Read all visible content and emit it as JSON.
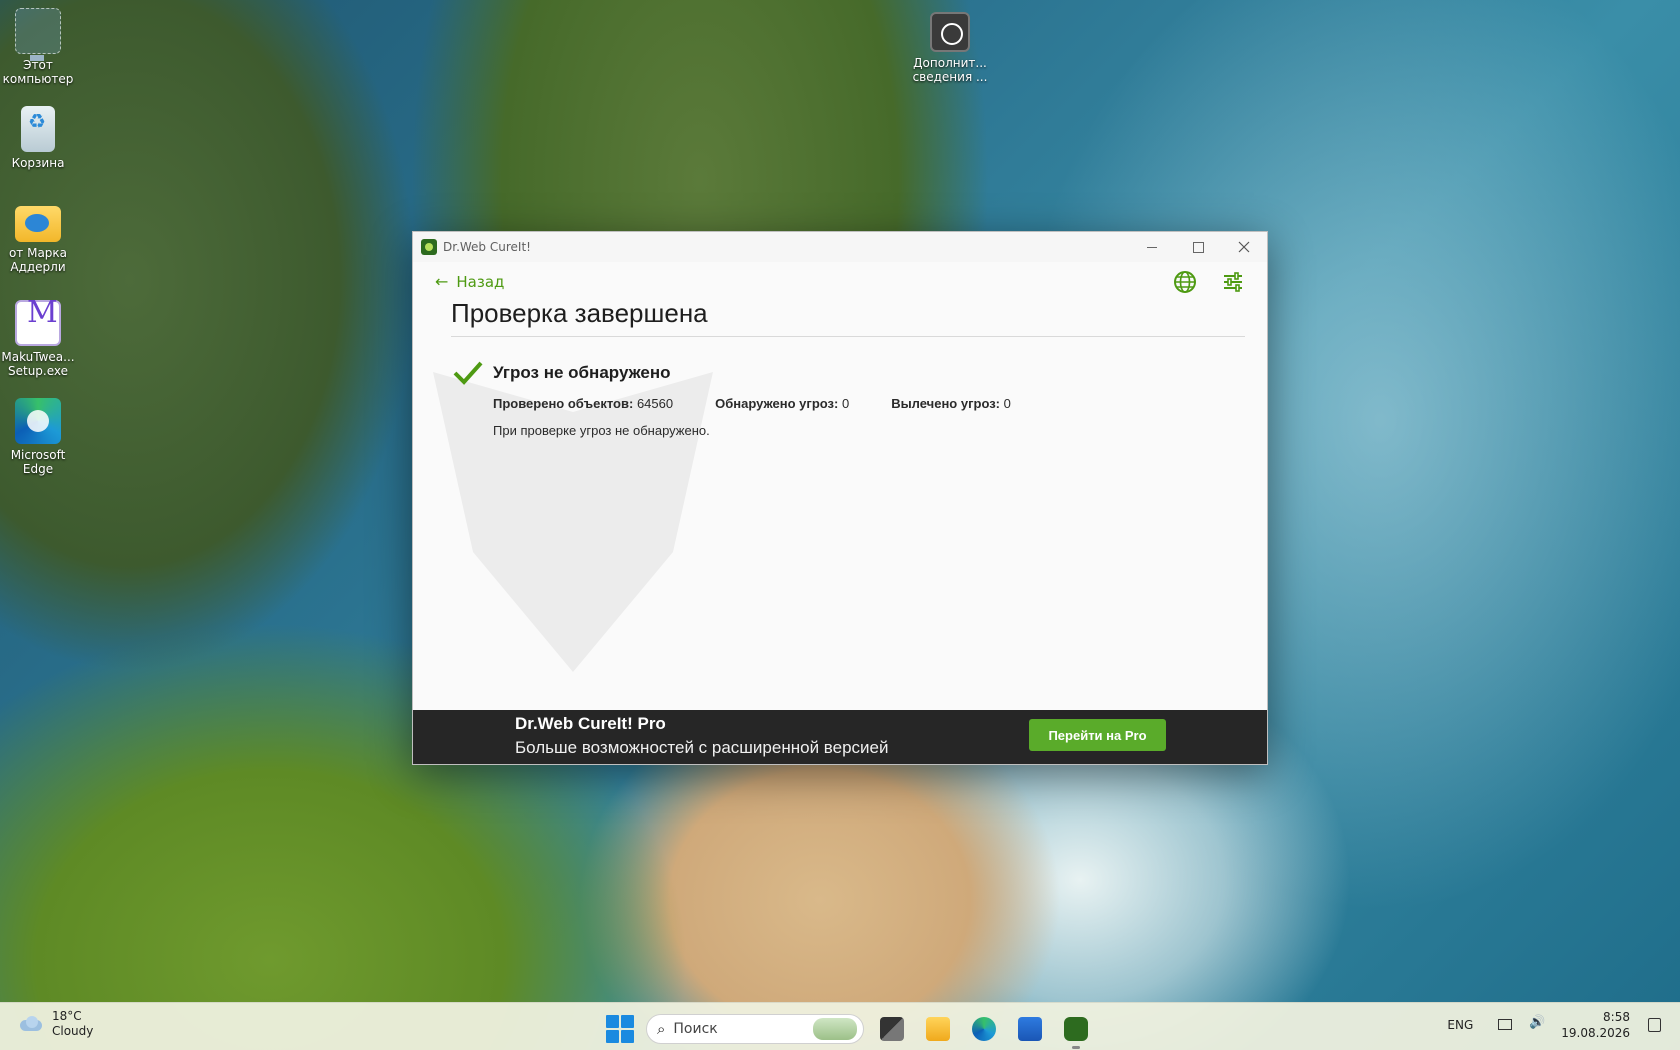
{
  "desktop": {
    "icons": [
      {
        "label": "Этот компьютер"
      },
      {
        "label": "Корзина"
      },
      {
        "label": "от Марка Аддерли"
      },
      {
        "label": "MakuTweaker Setup.exe",
        "display": "MakuTwea... Setup.exe"
      },
      {
        "label": "Microsoft Edge"
      },
      {
        "label": "Дополнит... сведения ..."
      }
    ]
  },
  "window": {
    "title": "Dr.Web CureIt!",
    "back_label": "Назад",
    "page_title": "Проверка завершена",
    "result_text": "Угроз не обнаружено",
    "stats": {
      "checked_label": "Проверено объектов:",
      "checked_value": "64560",
      "found_label": "Обнаружено угроз:",
      "found_value": "0",
      "cured_label": "Вылечено угроз:",
      "cured_value": "0"
    },
    "note": "При проверке угроз не обнаружено.",
    "promo": {
      "title": "Dr.Web CureIt! Pro",
      "subtitle": "Больше возможностей с расширенной версией",
      "button": "Перейти на Pro"
    },
    "accent_color": "#5aab2a"
  },
  "taskbar": {
    "weather": {
      "temp": "18°C",
      "condition": "Cloudy"
    },
    "search_placeholder": "Поиск",
    "apps": [
      "start-icon",
      "task-view-icon",
      "file-explorer-icon",
      "edge-icon",
      "store-icon",
      "drweb-icon"
    ],
    "lang": "ENG",
    "time": "8:58",
    "date": "19.08.2026"
  }
}
